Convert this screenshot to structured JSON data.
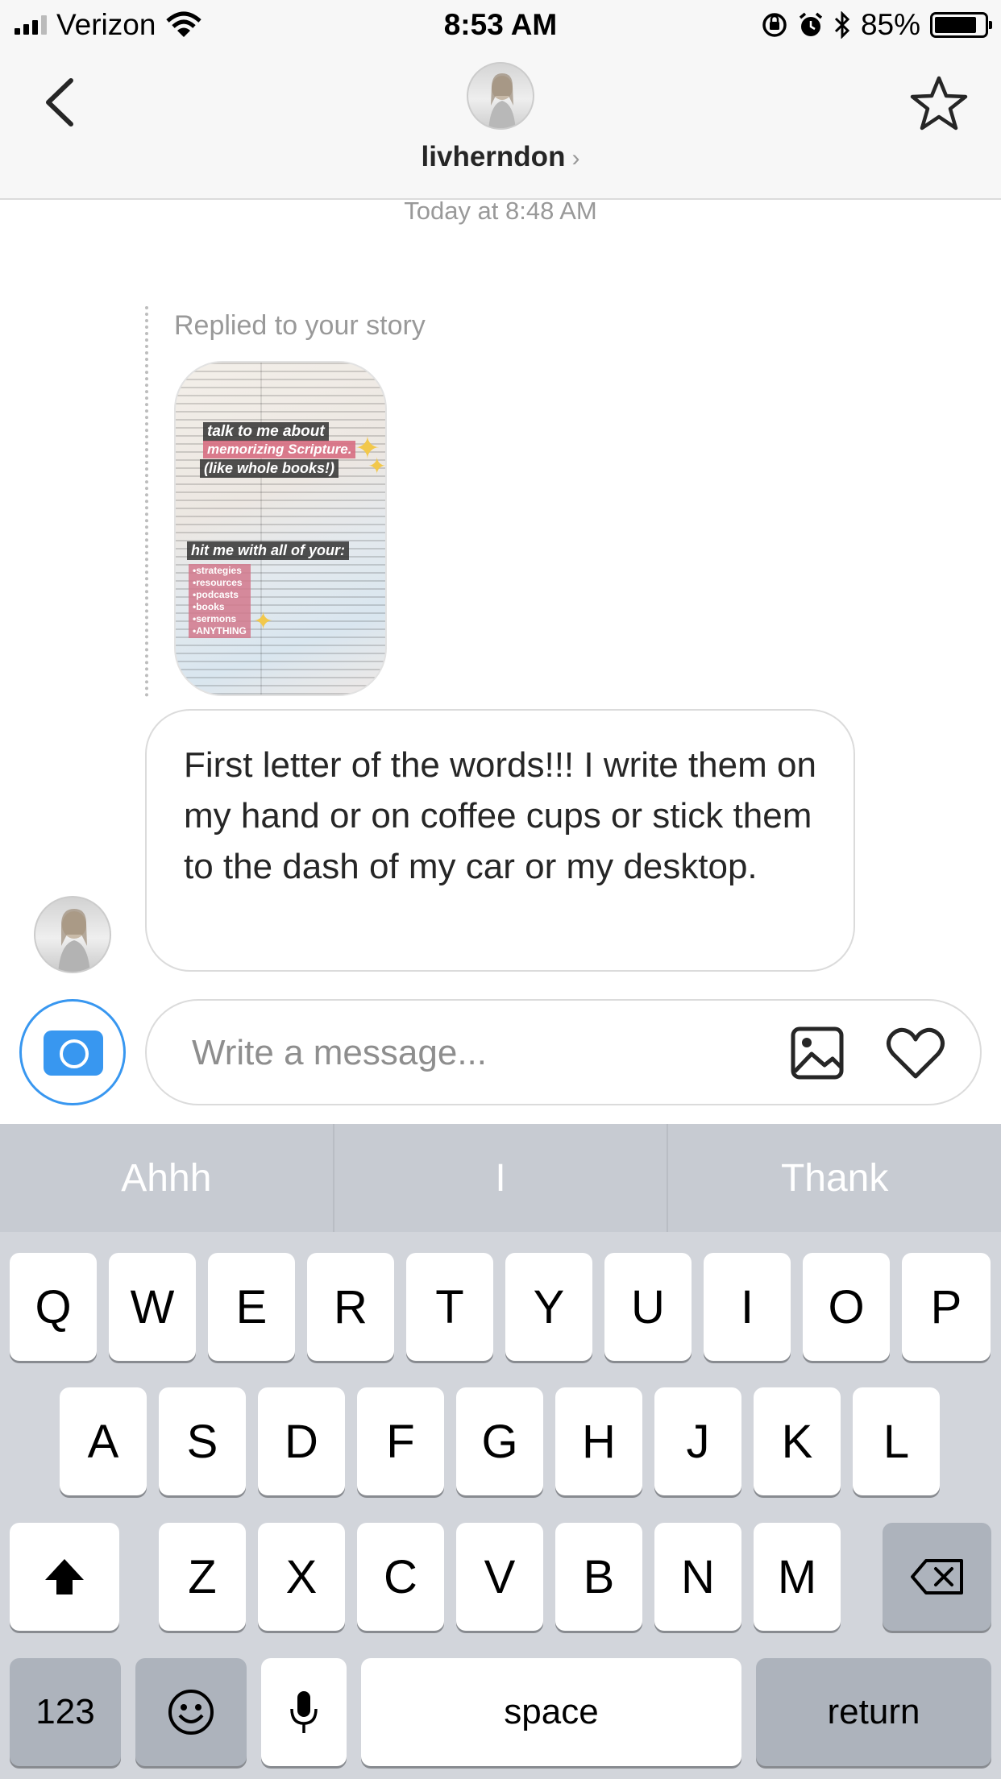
{
  "status_bar": {
    "carrier": "Verizon",
    "time": "8:53 AM",
    "battery": "85%",
    "battery_level": 0.85
  },
  "header": {
    "username": "livherndon",
    "chevron": "›",
    "icons": [
      "back-chevron-icon",
      "star-icon",
      "avatar"
    ]
  },
  "conversation": {
    "timestamp": "Today at 8:48 AM",
    "reply_label": "Replied to your story",
    "story": {
      "line1": "talk to me about",
      "line2": "memorizing Scripture.",
      "line3": "(like whole books!)",
      "line4": "hit me with all of your:",
      "list": [
        "•strategies",
        "•resources",
        "•podcasts",
        "•books",
        "•sermons",
        "•ANYTHING"
      ]
    },
    "message": "First letter of the words!!! I write them on my hand or on coffee cups or stick them to the dash of my car or my desktop."
  },
  "composer": {
    "placeholder": "Write a message...",
    "icons": [
      "camera-icon",
      "gallery-icon",
      "heart-icon"
    ]
  },
  "keyboard": {
    "suggestions": [
      "Ahhh",
      "I",
      "Thank"
    ],
    "row1": [
      "Q",
      "W",
      "E",
      "R",
      "T",
      "Y",
      "U",
      "I",
      "O",
      "P"
    ],
    "row2": [
      "A",
      "S",
      "D",
      "F",
      "G",
      "H",
      "J",
      "K",
      "L"
    ],
    "row3": [
      "Z",
      "X",
      "C",
      "V",
      "B",
      "N",
      "M"
    ],
    "numbers": "123",
    "space": "space",
    "return": "return"
  }
}
